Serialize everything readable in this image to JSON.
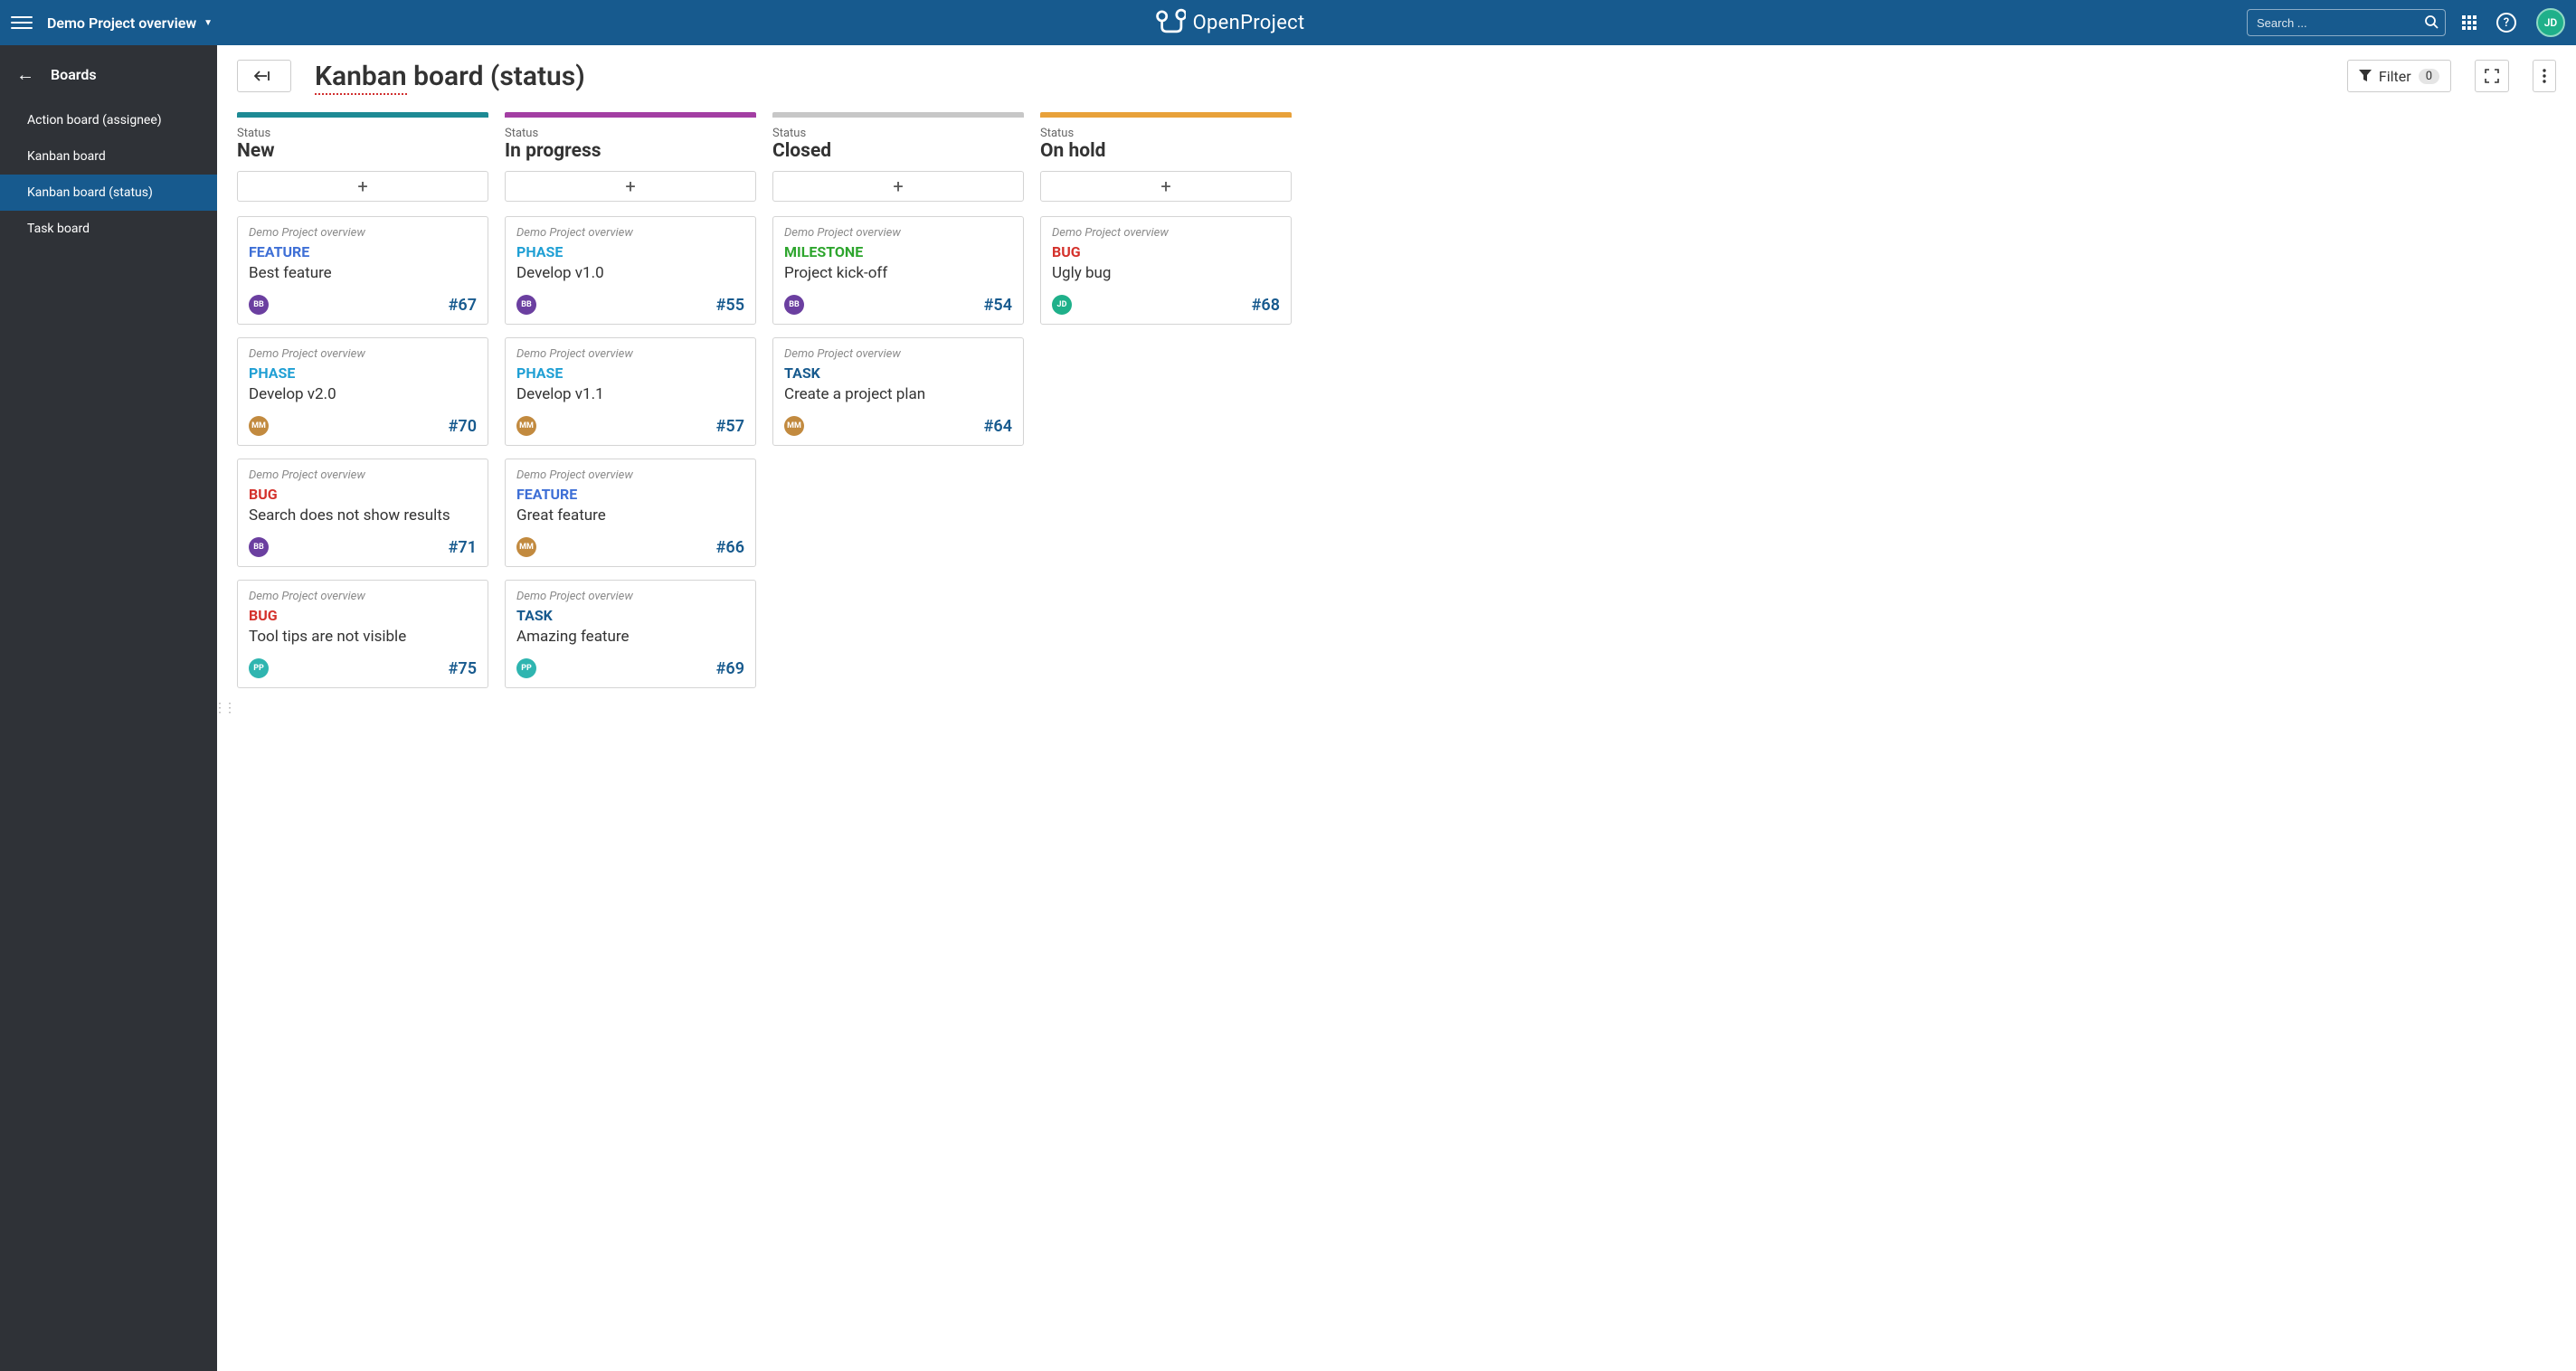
{
  "nav": {
    "project_title": "Demo Project overview",
    "logo_text": "OpenProject",
    "search_placeholder": "Search ...",
    "user_initials": "JD"
  },
  "sidebar": {
    "title": "Boards",
    "items": [
      {
        "label": "Action board (assignee)",
        "active": false
      },
      {
        "label": "Kanban board",
        "active": false
      },
      {
        "label": "Kanban board (status)",
        "active": true
      },
      {
        "label": "Task board",
        "active": false
      }
    ]
  },
  "page": {
    "title_editable": "Kanban",
    "title_rest": " board (status)",
    "filter_label": "Filter",
    "filter_count": "0"
  },
  "board": {
    "status_label": "Status",
    "columns": [
      {
        "title": "New",
        "color": "#1d8a94",
        "cards": [
          {
            "project": "Demo Project overview",
            "type": "FEATURE",
            "subject": "Best feature",
            "assignee": "BB",
            "id": "#67"
          },
          {
            "project": "Demo Project overview",
            "type": "PHASE",
            "subject": "Develop v2.0",
            "assignee": "MM",
            "id": "#70"
          },
          {
            "project": "Demo Project overview",
            "type": "BUG",
            "subject": "Search does not show results",
            "assignee": "BB",
            "id": "#71"
          },
          {
            "project": "Demo Project overview",
            "type": "BUG",
            "subject": "Tool tips are not visible",
            "assignee": "PP",
            "id": "#75"
          }
        ]
      },
      {
        "title": "In progress",
        "color": "#a33ea3",
        "cards": [
          {
            "project": "Demo Project overview",
            "type": "PHASE",
            "subject": "Develop v1.0",
            "assignee": "BB",
            "id": "#55"
          },
          {
            "project": "Demo Project overview",
            "type": "PHASE",
            "subject": "Develop v1.1",
            "assignee": "MM",
            "id": "#57"
          },
          {
            "project": "Demo Project overview",
            "type": "FEATURE",
            "subject": "Great feature",
            "assignee": "MM",
            "id": "#66"
          },
          {
            "project": "Demo Project overview",
            "type": "TASK",
            "subject": "Amazing feature",
            "assignee": "PP",
            "id": "#69"
          }
        ]
      },
      {
        "title": "Closed",
        "color": "#c7c7c7",
        "cards": [
          {
            "project": "Demo Project overview",
            "type": "MILESTONE",
            "subject": "Project kick-off",
            "assignee": "BB",
            "id": "#54"
          },
          {
            "project": "Demo Project overview",
            "type": "TASK",
            "subject": "Create a project plan",
            "assignee": "MM",
            "id": "#64"
          }
        ]
      },
      {
        "title": "On hold",
        "color": "#e8a13a",
        "cards": [
          {
            "project": "Demo Project overview",
            "type": "BUG",
            "subject": "Ugly bug",
            "assignee": "JD",
            "id": "#68"
          }
        ]
      }
    ]
  }
}
